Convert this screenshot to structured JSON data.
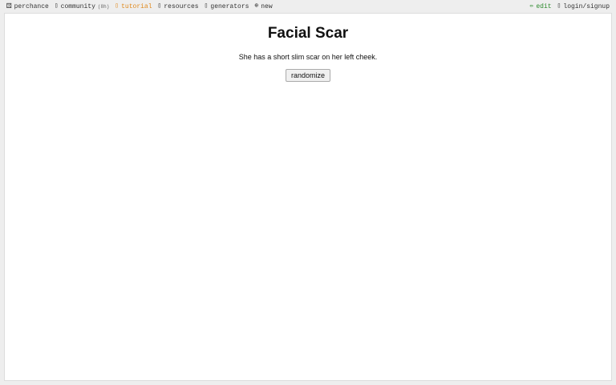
{
  "nav": {
    "left": [
      {
        "icon": "⚄",
        "label": "perchance",
        "name": "brand"
      },
      {
        "icon": "▯",
        "label": "community",
        "count": "(8h)",
        "name": "community"
      },
      {
        "icon": "▯",
        "label": "tutorial",
        "name": "tutorial"
      },
      {
        "icon": "▯",
        "label": "resources",
        "name": "resources"
      },
      {
        "icon": "▯",
        "label": "generators",
        "name": "generators"
      },
      {
        "icon": "⊕",
        "label": "new",
        "name": "new"
      }
    ],
    "right": [
      {
        "icon": "✏",
        "label": "edit",
        "name": "edit"
      },
      {
        "icon": "▯",
        "label": "login/signup",
        "name": "login"
      }
    ]
  },
  "main": {
    "title": "Facial Scar",
    "output": "She has a short slim scar on her left cheek.",
    "button_label": "randomize"
  },
  "colors": {
    "accent": "#e08a1e",
    "edit": "#2e8b2e",
    "background": "#eeeeee",
    "card": "#ffffff"
  }
}
